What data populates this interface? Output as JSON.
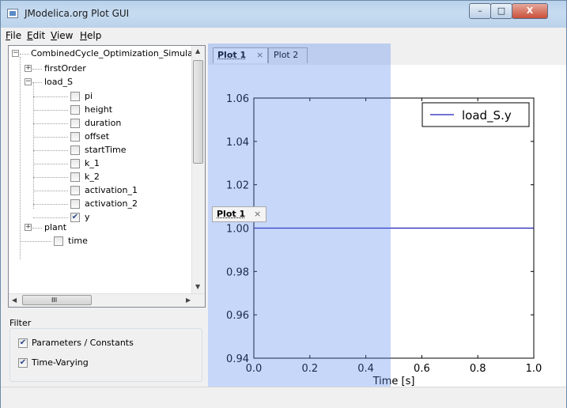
{
  "window": {
    "title": "JModelica.org Plot GUI",
    "controls": {
      "minimize": "–",
      "maximize": "□",
      "close": "X"
    }
  },
  "menubar": {
    "items": [
      {
        "label": "File",
        "mnemonic": "F"
      },
      {
        "label": "Edit",
        "mnemonic": "E"
      },
      {
        "label": "View",
        "mnemonic": "V"
      },
      {
        "label": "Help",
        "mnemonic": "H"
      }
    ]
  },
  "tree": {
    "root": "CombinedCycle_Optimization_Simulator",
    "nodes": [
      {
        "label": "firstOrder",
        "expander": "+"
      },
      {
        "label": "load_S",
        "expander": "−"
      },
      {
        "label": "plant",
        "expander": "+"
      }
    ],
    "load_S_children": [
      {
        "label": "pi",
        "checked": false
      },
      {
        "label": "height",
        "checked": false
      },
      {
        "label": "duration",
        "checked": false
      },
      {
        "label": "offset",
        "checked": false
      },
      {
        "label": "startTime",
        "checked": false
      },
      {
        "label": "k_1",
        "checked": false
      },
      {
        "label": "k_2",
        "checked": false
      },
      {
        "label": "activation_1",
        "checked": false
      },
      {
        "label": "activation_2",
        "checked": false
      },
      {
        "label": "y",
        "checked": true
      }
    ],
    "time": {
      "label": "time",
      "checked": false
    },
    "hscroll_grip": "III"
  },
  "filter": {
    "title": "Filter",
    "options": [
      {
        "label": "Parameters / Constants",
        "checked": true
      },
      {
        "label": "Time-Varying",
        "checked": true
      }
    ]
  },
  "tabs": [
    {
      "label": "Plot 1",
      "close": "×",
      "active": true
    },
    {
      "label": "Plot 2",
      "active": false
    }
  ],
  "floating_tab": {
    "label": "Plot 1",
    "close": "×"
  },
  "colors": {
    "line": "#1f1fb4",
    "overlay": "#5082f0",
    "check": "#2a4a8a"
  },
  "chart_data": {
    "type": "line",
    "xlabel": "Time [s]",
    "ylabel": "",
    "xlim": [
      0.0,
      1.0
    ],
    "ylim": [
      0.94,
      1.06
    ],
    "xticks": [
      "0.0",
      "0.2",
      "0.4",
      "0.6",
      "0.8",
      "1.0"
    ],
    "yticks": [
      "0.94",
      "0.96",
      "0.98",
      "1.00",
      "1.02",
      "1.04",
      "1.06"
    ],
    "legend_position": "top-right",
    "grid": false,
    "series": [
      {
        "name": "load_S.y",
        "x": [
          0.0,
          1.0
        ],
        "y": [
          1.0,
          1.0
        ]
      }
    ]
  }
}
